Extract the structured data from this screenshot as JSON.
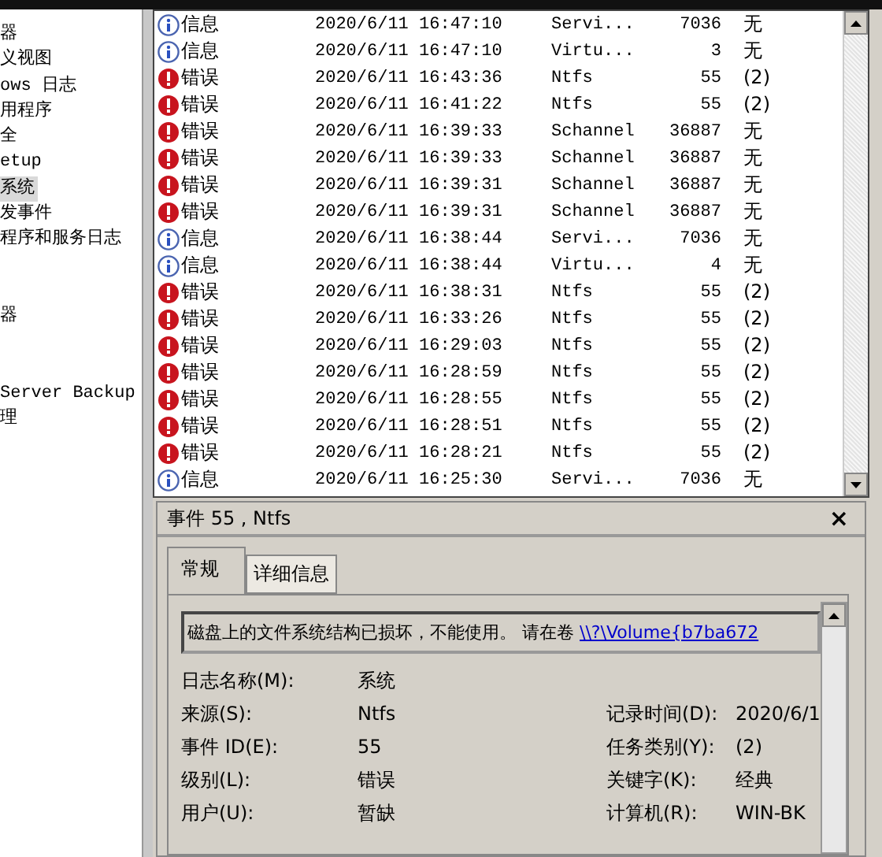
{
  "sidebar": {
    "items": [
      {
        "label": "器",
        "selected": false
      },
      {
        "label": "义视图",
        "selected": false
      },
      {
        "label": "ows 日志",
        "selected": false
      },
      {
        "label": "用程序",
        "selected": false
      },
      {
        "label": "全",
        "selected": false
      },
      {
        "label": "etup",
        "selected": false
      },
      {
        "label": "系统",
        "selected": true
      },
      {
        "label": "发事件",
        "selected": false
      },
      {
        "label": "程序和服务日志",
        "selected": false
      },
      {
        "kind": "spacer"
      },
      {
        "kind": "spacer"
      },
      {
        "label": "器",
        "selected": false
      },
      {
        "kind": "spacer"
      },
      {
        "kind": "spacer"
      },
      {
        "label": "Server Backup",
        "selected": false
      },
      {
        "label": "理",
        "selected": false
      }
    ]
  },
  "events": {
    "rows": [
      {
        "kind": "info",
        "level": "信息",
        "date": "2020/6/11 16:47:10",
        "source": "Servi...",
        "event_id": "7036",
        "category": "无"
      },
      {
        "kind": "info",
        "level": "信息",
        "date": "2020/6/11 16:47:10",
        "source": "Virtu...",
        "event_id": "3",
        "category": "无"
      },
      {
        "kind": "error",
        "level": "错误",
        "date": "2020/6/11 16:43:36",
        "source": "Ntfs",
        "event_id": "55",
        "category": "(2)"
      },
      {
        "kind": "error",
        "level": "错误",
        "date": "2020/6/11 16:41:22",
        "source": "Ntfs",
        "event_id": "55",
        "category": "(2)"
      },
      {
        "kind": "error",
        "level": "错误",
        "date": "2020/6/11 16:39:33",
        "source": "Schannel",
        "event_id": "36887",
        "category": "无"
      },
      {
        "kind": "error",
        "level": "错误",
        "date": "2020/6/11 16:39:33",
        "source": "Schannel",
        "event_id": "36887",
        "category": "无"
      },
      {
        "kind": "error",
        "level": "错误",
        "date": "2020/6/11 16:39:31",
        "source": "Schannel",
        "event_id": "36887",
        "category": "无"
      },
      {
        "kind": "error",
        "level": "错误",
        "date": "2020/6/11 16:39:31",
        "source": "Schannel",
        "event_id": "36887",
        "category": "无"
      },
      {
        "kind": "info",
        "level": "信息",
        "date": "2020/6/11 16:38:44",
        "source": "Servi...",
        "event_id": "7036",
        "category": "无"
      },
      {
        "kind": "info",
        "level": "信息",
        "date": "2020/6/11 16:38:44",
        "source": "Virtu...",
        "event_id": "4",
        "category": "无"
      },
      {
        "kind": "error",
        "level": "错误",
        "date": "2020/6/11 16:38:31",
        "source": "Ntfs",
        "event_id": "55",
        "category": "(2)"
      },
      {
        "kind": "error",
        "level": "错误",
        "date": "2020/6/11 16:33:26",
        "source": "Ntfs",
        "event_id": "55",
        "category": "(2)"
      },
      {
        "kind": "error",
        "level": "错误",
        "date": "2020/6/11 16:29:03",
        "source": "Ntfs",
        "event_id": "55",
        "category": "(2)"
      },
      {
        "kind": "error",
        "level": "错误",
        "date": "2020/6/11 16:28:59",
        "source": "Ntfs",
        "event_id": "55",
        "category": "(2)"
      },
      {
        "kind": "error",
        "level": "错误",
        "date": "2020/6/11 16:28:55",
        "source": "Ntfs",
        "event_id": "55",
        "category": "(2)"
      },
      {
        "kind": "error",
        "level": "错误",
        "date": "2020/6/11 16:28:51",
        "source": "Ntfs",
        "event_id": "55",
        "category": "(2)"
      },
      {
        "kind": "error",
        "level": "错误",
        "date": "2020/6/11 16:28:21",
        "source": "Ntfs",
        "event_id": "55",
        "category": "(2)"
      },
      {
        "kind": "info",
        "level": "信息",
        "date": "2020/6/11 16:25:30",
        "source": "Servi...",
        "event_id": "7036",
        "category": "无"
      }
    ]
  },
  "detail": {
    "title": "事件 55 , Ntfs",
    "close": "×",
    "tabs": [
      {
        "label": "常规",
        "selected": true
      },
      {
        "label": "详细信息",
        "selected": false
      }
    ],
    "message": {
      "text": "磁盘上的文件系统结构已损坏，不能使用。 请在卷 ",
      "link": "\\\\?\\Volume{b7ba672"
    },
    "fields": [
      {
        "label": "日志名称(M):",
        "value": "系统"
      },
      {
        "label": "来源(S):",
        "value": "Ntfs",
        "right_label": "记录时间(D):",
        "right_value": "2020/6/1"
      },
      {
        "label": "事件 ID(E):",
        "value": "55",
        "right_label": "任务类别(Y):",
        "right_value": "(2)"
      },
      {
        "label": "级别(L):",
        "value": "错误",
        "right_label": "关键字(K):",
        "right_value": "经典"
      },
      {
        "label": "用户(U):",
        "value": "暂缺",
        "right_label": "计算机(R):",
        "right_value": "WIN-BK"
      }
    ]
  }
}
